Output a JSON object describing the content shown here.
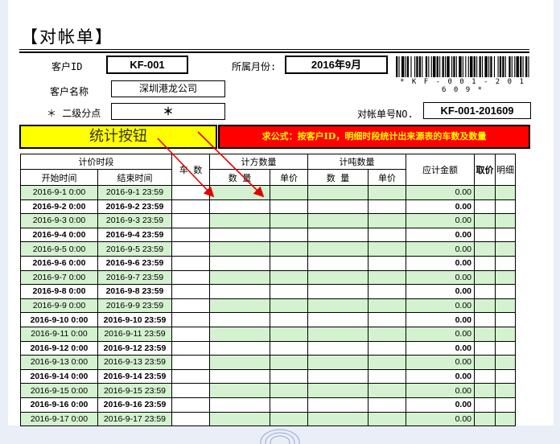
{
  "title": "【对帐单】",
  "header": {
    "customer_id_label": "客户ID",
    "customer_id": "KF-001",
    "month_label": "所属月份:",
    "month": "2016年9月",
    "customer_name_label": "客户名称",
    "customer_name": "深圳港龙公司",
    "branch_label": "＊ 二级分点",
    "branch": "＊",
    "statement_no_label": "对帐单号NO.",
    "statement_no": "KF-001-201609",
    "barcode_text": "* K F - 0 0 1 - 2 0 1 6 0 9 *"
  },
  "button_label": "统计按钮",
  "formula_banner": "求公式：按客户ID，明细时段统计出来源表的车数及数量",
  "table": {
    "h_period": "计价时段",
    "h_trips": "车 数",
    "h_volume": "计方数量",
    "h_ton": "计吨数量",
    "h_amount": "应计金额",
    "h_price_pick": "取价",
    "h_detail": "明细",
    "h_start": "开始时间",
    "h_end": "结束时间",
    "h_qty1": "数 量",
    "h_unit1": "单价",
    "h_qty2": "数 量",
    "h_unit2": "单价",
    "rows": [
      {
        "start": "2016-9-1 0:00",
        "end": "2016-9-1 23:59",
        "amount": "0.00"
      },
      {
        "start": "2016-9-2 0:00",
        "end": "2016-9-2 23:59",
        "amount": "0.00"
      },
      {
        "start": "2016-9-3 0:00",
        "end": "2016-9-3 23:59",
        "amount": "0.00"
      },
      {
        "start": "2016-9-4 0:00",
        "end": "2016-9-4 23:59",
        "amount": "0.00"
      },
      {
        "start": "2016-9-5 0:00",
        "end": "2016-9-5 23:59",
        "amount": "0.00"
      },
      {
        "start": "2016-9-6 0:00",
        "end": "2016-9-6 23:59",
        "amount": "0.00"
      },
      {
        "start": "2016-9-7 0:00",
        "end": "2016-9-7 23:59",
        "amount": "0.00"
      },
      {
        "start": "2016-9-8 0:00",
        "end": "2016-9-8 23:59",
        "amount": "0.00"
      },
      {
        "start": "2016-9-9 0:00",
        "end": "2016-9-9 23:59",
        "amount": "0.00"
      },
      {
        "start": "2016-9-10 0:00",
        "end": "2016-9-10 23:59",
        "amount": "0.00"
      },
      {
        "start": "2016-9-11 0:00",
        "end": "2016-9-11 23:59",
        "amount": "0.00"
      },
      {
        "start": "2016-9-12 0:00",
        "end": "2016-9-12 23:59",
        "amount": "0.00"
      },
      {
        "start": "2016-9-13 0:00",
        "end": "2016-9-13 23:59",
        "amount": "0.00"
      },
      {
        "start": "2016-9-14 0:00",
        "end": "2016-9-14 23:59",
        "amount": "0.00"
      },
      {
        "start": "2016-9-15 0:00",
        "end": "2016-9-15 23:59",
        "amount": "0.00"
      },
      {
        "start": "2016-9-16 0:00",
        "end": "2016-9-16 23:59",
        "amount": "0.00"
      },
      {
        "start": "2016-9-17 0:00",
        "end": "2016-9-17 23:59",
        "amount": "0.00"
      }
    ]
  },
  "colors": {
    "row_green": "#d4f2cf",
    "button_yellow": "#ffff00",
    "banner_red": "#ff0000",
    "banner_text": "#ffff00",
    "arrow_red": "#e00000"
  }
}
